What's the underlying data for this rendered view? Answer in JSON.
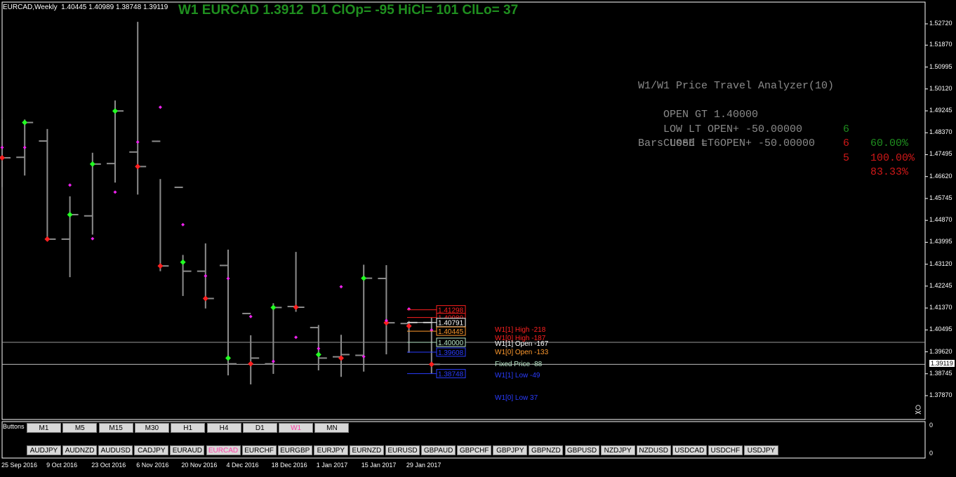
{
  "window": {
    "symbol_label": "EURCAD,Weekly  1.40445 1.40989 1.38748 1.39119",
    "headline": "W1 EURCAD 1.3912  D1 ClOp= -95 HiCl= 101 ClLo= 37"
  },
  "analyzer": {
    "title": "W1/W1 Price Travel Analyzer(10)",
    "rows": [
      {
        "label": "OPEN GT 1.40000",
        "count": "6",
        "pct": "60.00%",
        "color": "green"
      },
      {
        "label": "LOW LT OPEN+ -50.00000",
        "count": "6",
        "pct": "100.00%",
        "color": "red"
      },
      {
        "label": "CLOSE LT OPEN+ -50.00000",
        "count": "5",
        "pct": "83.33%",
        "color": "red"
      }
    ],
    "bars_used": "Bars Used = 6"
  },
  "price_axis": {
    "ticks": [
      "1.52720",
      "1.51870",
      "1.50995",
      "1.50120",
      "1.49245",
      "1.48370",
      "1.47495",
      "1.46620",
      "1.45745",
      "1.44870",
      "1.43995",
      "1.43120",
      "1.42245",
      "1.41370",
      "1.40495",
      "1.39620",
      "1.38745",
      "1.37870"
    ],
    "current_price": "1.39119",
    "sub_window_top": "0",
    "sub_window_bottom": "0"
  },
  "date_axis": [
    "25 Sep 2016",
    "9 Oct 2016",
    "23 Oct 2016",
    "6 Nov 2016",
    "20 Nov 2016",
    "4 Dec 2016",
    "18 Dec 2016",
    "1 Jan 2017",
    "15 Jan 2017",
    "29 Jan 2017"
  ],
  "level_boxes": [
    {
      "value": "1.41298",
      "color": "#ff2020"
    },
    {
      "value": "1.40989",
      "color": "#ff2020"
    },
    {
      "value": "1.40791",
      "color": "#ffffff"
    },
    {
      "value": "1.40445",
      "color": "#ff9a2e"
    },
    {
      "value": "1.40000",
      "color": "#b8e6c8"
    },
    {
      "value": "1.39608",
      "color": "#2a3cff"
    },
    {
      "value": "1.38748",
      "color": "#2a3cff"
    }
  ],
  "level_labels": [
    {
      "text": "W1[1] High  -218",
      "color": "#ff2020"
    },
    {
      "text": "W1[0] High  -187",
      "color": "#ff2020"
    },
    {
      "text": "W1[1] Open -167",
      "color": "#ffffff"
    },
    {
      "text": "W1[0] Open -133",
      "color": "#ff9a2e"
    },
    {
      "text": "Fixed Price  -88",
      "color": "#b8e6c8"
    },
    {
      "text": "W1[1] Low  -49",
      "color": "#2a3cff"
    },
    {
      "text": "W1[0] Low  37",
      "color": "#2a3cff"
    }
  ],
  "timeframe_bar": {
    "label": "Buttons",
    "buttons": [
      "M1",
      "M5",
      "M15",
      "M30",
      "H1",
      "H4",
      "D1",
      "W1",
      "MN"
    ],
    "active": "W1"
  },
  "symbol_bar": {
    "buttons": [
      "AUDJPY",
      "AUDNZD",
      "AUDUSD",
      "CADJPY",
      "EURAUD",
      "EURCAD",
      "EURCHF",
      "EURGBP",
      "EURJPY",
      "EURNZD",
      "EURUSD",
      "GBPAUD",
      "GBPCHF",
      "GBPJPY",
      "GBPNZD",
      "GBPUSD",
      "NZDJPY",
      "NZDUSD",
      "USDCAD",
      "USDCHF",
      "USDJPY"
    ],
    "active": "EURCAD"
  },
  "colors": {
    "background": "#000000",
    "bar": "#8c8c8c",
    "headline": "#1f8f1f",
    "up_marker": "#22ff22",
    "down_marker": "#ff2020",
    "magenta_marker": "#ee22ee",
    "active_button_text": "#ff3fa6"
  },
  "chart_data": {
    "type": "ohlc",
    "x": [
      "2016-09-18",
      "2016-09-25",
      "2016-10-02",
      "2016-10-09",
      "2016-10-16",
      "2016-10-23",
      "2016-10-30",
      "2016-11-06",
      "2016-11-13",
      "2016-11-20",
      "2016-11-27",
      "2016-12-04",
      "2016-12-11",
      "2016-12-18",
      "2016-12-25",
      "2017-01-01",
      "2017-01-08",
      "2017-01-15",
      "2017-01-22",
      "2017-01-29"
    ],
    "series": [
      {
        "open": [
          1.474,
          1.4739,
          1.4804,
          1.4412,
          1.4505,
          1.4714,
          1.476,
          1.4803,
          1.4619,
          1.4284,
          1.4307,
          1.4115,
          1.3914,
          1.4143,
          1.4059,
          1.3942,
          1.3948,
          1.4255,
          1.4075,
          1.4079
        ],
        "high": [
          1.489,
          1.489,
          1.4852,
          1.4583,
          1.4757,
          1.4966,
          1.528,
          1.4652,
          1.4349,
          1.4395,
          1.437,
          1.4028,
          1.4156,
          1.4361,
          1.4069,
          1.403,
          1.431,
          1.4308,
          1.4085,
          1.4099
        ],
        "low": [
          1.462,
          1.4666,
          1.4409,
          1.426,
          1.443,
          1.4638,
          1.459,
          1.4284,
          1.4185,
          1.4135,
          1.3868,
          1.3832,
          1.3874,
          1.4122,
          1.3888,
          1.3862,
          1.3883,
          1.3952,
          1.3958,
          1.3875
        ],
        "close": [
          1.4737,
          1.4878,
          1.4412,
          1.451,
          1.4712,
          1.4924,
          1.4702,
          1.4305,
          1.4284,
          1.4175,
          1.3914,
          1.3937,
          1.4139,
          1.414,
          1.3937,
          1.3951,
          1.4256,
          1.4078,
          1.4079,
          1.3912
        ]
      }
    ],
    "ylim": [
      1.377,
      1.531
    ],
    "markers": {
      "green": [
        [
          1,
          1.4878
        ],
        [
          3,
          1.451
        ],
        [
          4,
          1.4712
        ],
        [
          5,
          1.4924
        ],
        [
          8,
          1.432
        ],
        [
          10,
          1.3937
        ],
        [
          12,
          1.4139
        ],
        [
          14,
          1.3951
        ],
        [
          16,
          1.4256
        ]
      ],
      "red": [
        [
          0,
          1.4737
        ],
        [
          2,
          1.4412
        ],
        [
          6,
          1.4702
        ],
        [
          7,
          1.4305
        ],
        [
          9,
          1.4175
        ],
        [
          11,
          1.3914
        ],
        [
          13,
          1.414
        ],
        [
          15,
          1.3937
        ],
        [
          17,
          1.4078
        ],
        [
          18,
          1.4065
        ],
        [
          19,
          1.3912
        ]
      ],
      "magenta": [
        [
          0,
          1.4778
        ],
        [
          1,
          1.4778
        ],
        [
          3,
          1.4628
        ],
        [
          4,
          1.4414
        ],
        [
          5,
          1.46
        ],
        [
          6,
          1.48
        ],
        [
          7,
          1.4939
        ],
        [
          8,
          1.447
        ],
        [
          9,
          1.4265
        ],
        [
          10,
          1.4255
        ],
        [
          11,
          1.4103
        ],
        [
          12,
          1.3924
        ],
        [
          13,
          1.402
        ],
        [
          14,
          1.3975
        ],
        [
          15,
          1.4222
        ],
        [
          16,
          1.3943
        ],
        [
          17,
          1.4087
        ],
        [
          18,
          1.4133
        ],
        [
          19,
          1.4049
        ]
      ]
    },
    "horizontal_levels": [
      1.4,
      1.39119
    ]
  }
}
